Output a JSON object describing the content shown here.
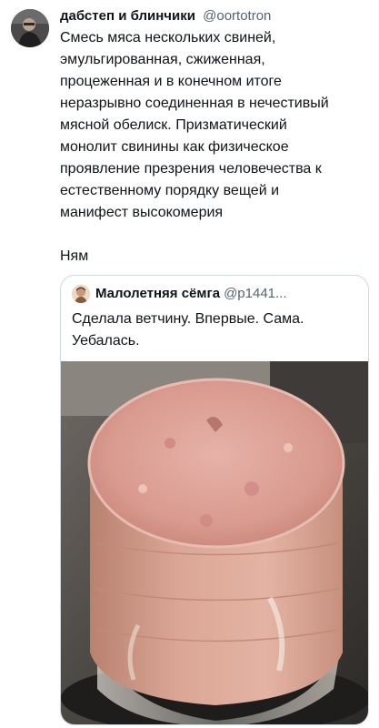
{
  "tweet": {
    "display_name": "дабстеп и блинчики",
    "handle": "@oortotron",
    "text": "Смесь мяса нескольких свиней,\nэмульгированная, сжиженная,\nпроцеженная и в конечном итоге\nнеразрывно соединенная в нечестивый\nмясной обелиск. Призматический\nмонолит свинины как физическое\nпроявление презрения человечества к\nестественному порядку вещей и\nманифест высокомерия",
    "text_2": "Ням"
  },
  "quote": {
    "display_name": "Малолетняя сёмга",
    "handle": "@p1441...",
    "text": "Сделала ветчину. Впервые. Сама. Уебалась."
  }
}
